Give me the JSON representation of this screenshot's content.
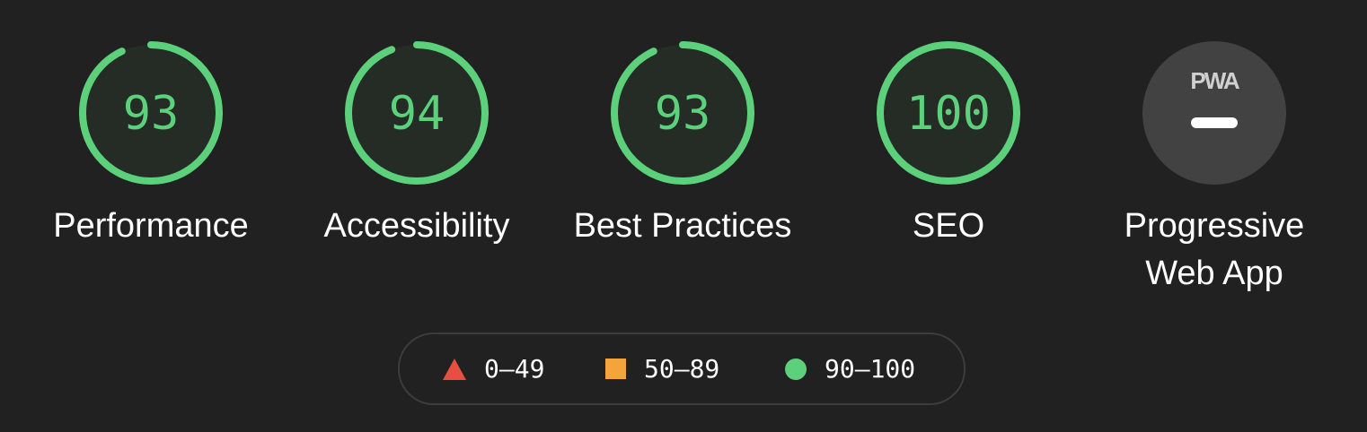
{
  "colors": {
    "background": "#212121",
    "pass": "#5cd07a",
    "pass_track": "#242c25",
    "average": "#f5a33b",
    "fail": "#e64f42",
    "pwa_fill": "#424242"
  },
  "gauges": [
    {
      "label": "Performance",
      "score": 93
    },
    {
      "label": "Accessibility",
      "score": 94
    },
    {
      "label": "Best Practices",
      "score": 93
    },
    {
      "label": "SEO",
      "score": 100
    }
  ],
  "pwa": {
    "label": "Progressive\nWeb App",
    "logo_text": "PWA",
    "icon": "pwa-logo-icon"
  },
  "legend": [
    {
      "range": "0–49",
      "icon": "triangle-icon",
      "color": "#e64f42"
    },
    {
      "range": "50–89",
      "icon": "square-icon",
      "color": "#f5a33b"
    },
    {
      "range": "90–100",
      "icon": "circle-icon",
      "color": "#5cd07a"
    }
  ]
}
